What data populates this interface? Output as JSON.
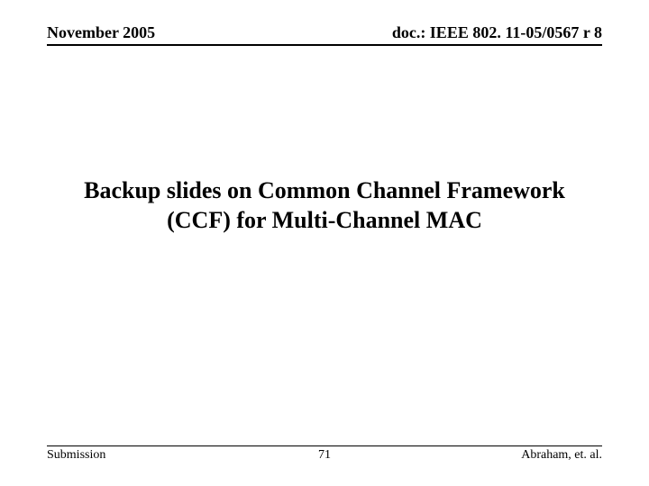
{
  "header": {
    "date": "November 2005",
    "doc_ref": "doc.: IEEE 802. 11-05/0567 r 8"
  },
  "title": {
    "line1": "Backup slides on Common Channel Framework",
    "line2": "(CCF) for Multi-Channel MAC"
  },
  "footer": {
    "left": "Submission",
    "center": "71",
    "right": "Abraham, et. al."
  }
}
